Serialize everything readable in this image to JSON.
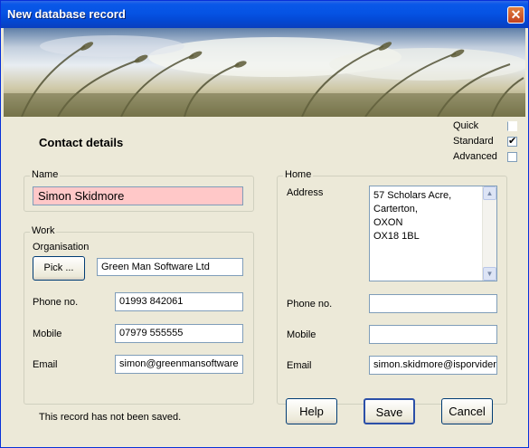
{
  "window": {
    "title": "New database record",
    "close_glyph": "✕"
  },
  "heading": "Contact details",
  "view_options": [
    {
      "label": "Quick",
      "checked": false
    },
    {
      "label": "Standard",
      "checked": true
    },
    {
      "label": "Advanced",
      "checked": false
    }
  ],
  "name_group": {
    "legend": "Name",
    "value": "Simon Skidmore",
    "highlight_color": "#ffc8c8"
  },
  "work_group": {
    "legend": "Work",
    "organisation_label": "Organisation",
    "pick_label": "Pick ...",
    "organisation_value": "Green Man Software Ltd",
    "phone_label": "Phone no.",
    "phone_value": "01993 842061",
    "mobile_label": "Mobile",
    "mobile_value": "07979 555555",
    "email_label": "Email",
    "email_value": "simon@greenmansoftware"
  },
  "home_group": {
    "legend": "Home",
    "address_label": "Address",
    "address_lines": [
      "57 Scholars Acre,",
      "Carterton,",
      "OXON",
      "OX18 1BL"
    ],
    "phone_label": "Phone no.",
    "phone_value": "",
    "mobile_label": "Mobile",
    "mobile_value": "",
    "email_label": "Email",
    "email_value": "simon.skidmore@isporvider"
  },
  "status_text": "This record has not been saved.",
  "buttons": {
    "help": "Help",
    "save": "Save",
    "cancel": "Cancel"
  },
  "colors": {
    "title_bar": "#0553e4",
    "dialog_bg": "#ece9d8",
    "close_button": "#d5542c"
  }
}
